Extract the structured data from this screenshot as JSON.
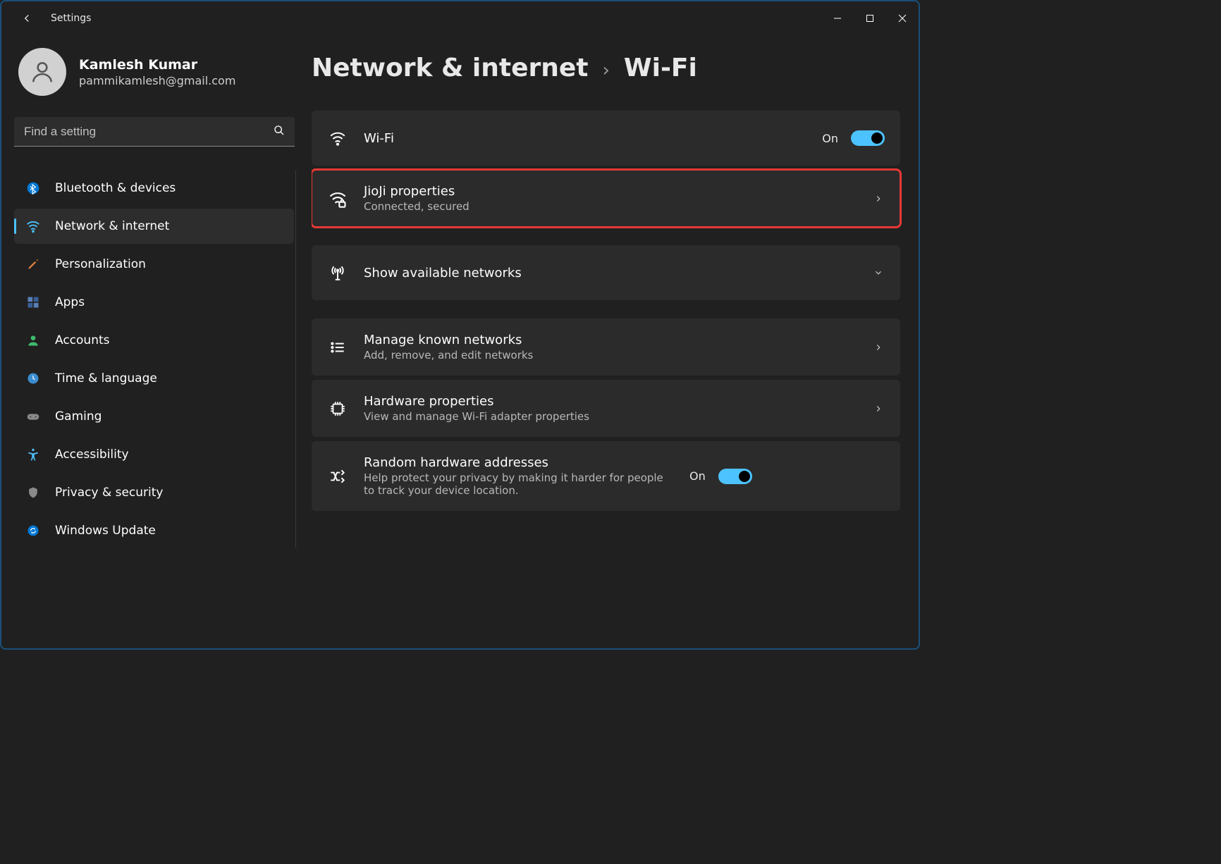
{
  "window": {
    "title": "Settings"
  },
  "profile": {
    "name": "Kamlesh Kumar",
    "email": "pammikamlesh@gmail.com"
  },
  "search": {
    "placeholder": "Find a setting"
  },
  "sidebar": {
    "items": [
      {
        "label": "Bluetooth & devices"
      },
      {
        "label": "Network & internet"
      },
      {
        "label": "Personalization"
      },
      {
        "label": "Apps"
      },
      {
        "label": "Accounts"
      },
      {
        "label": "Time & language"
      },
      {
        "label": "Gaming"
      },
      {
        "label": "Accessibility"
      },
      {
        "label": "Privacy & security"
      },
      {
        "label": "Windows Update"
      }
    ]
  },
  "breadcrumb": {
    "parent": "Network & internet",
    "current": "Wi-Fi"
  },
  "cards": {
    "wifi": {
      "title": "Wi-Fi",
      "state_label": "On"
    },
    "properties": {
      "title": "JioJi properties",
      "subtitle": "Connected, secured"
    },
    "available": {
      "title": "Show available networks"
    },
    "known": {
      "title": "Manage known networks",
      "subtitle": "Add, remove, and edit networks"
    },
    "hardware": {
      "title": "Hardware properties",
      "subtitle": "View and manage Wi-Fi adapter properties"
    },
    "random": {
      "title": "Random hardware addresses",
      "subtitle": "Help protect your privacy by making it harder for people to track your device location.",
      "state_label": "On"
    }
  }
}
